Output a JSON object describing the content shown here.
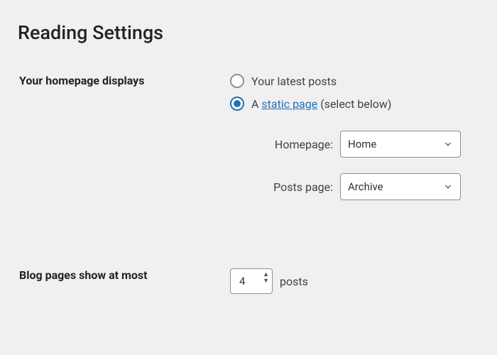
{
  "page_title": "Reading Settings",
  "homepage_displays": {
    "label": "Your homepage displays",
    "options": {
      "latest_posts": {
        "label": "Your latest posts",
        "selected": false
      },
      "static_page": {
        "prefix": "A ",
        "link_text": "static page",
        "suffix": " (select below)",
        "selected": true
      }
    },
    "homepage_select": {
      "label": "Homepage:",
      "value": "Home"
    },
    "posts_page_select": {
      "label": "Posts page:",
      "value": "Archive"
    }
  },
  "blog_pages": {
    "label": "Blog pages show at most",
    "value": "4",
    "unit": "posts"
  }
}
